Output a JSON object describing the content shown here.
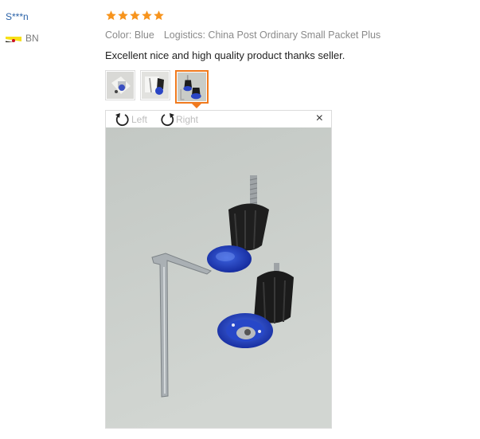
{
  "review": {
    "user_name": "S***n",
    "country": "BN",
    "rating": 5,
    "color_label": "Color: Blue",
    "logistics_label": "Logistics: China Post Ordinary Small Packet Plus",
    "text": "Excellent nice and high quality product thanks seller."
  },
  "thumbnails": {
    "count": 3,
    "selected_index": 2
  },
  "viewer": {
    "rotate_left_label": "Left",
    "rotate_right_label": "Right",
    "close_symbol": "×"
  },
  "colors": {
    "star": "#f7941d",
    "link": "#2a62a8",
    "selected_border": "#f07a1e",
    "product_blue": "#1f3fbf"
  }
}
